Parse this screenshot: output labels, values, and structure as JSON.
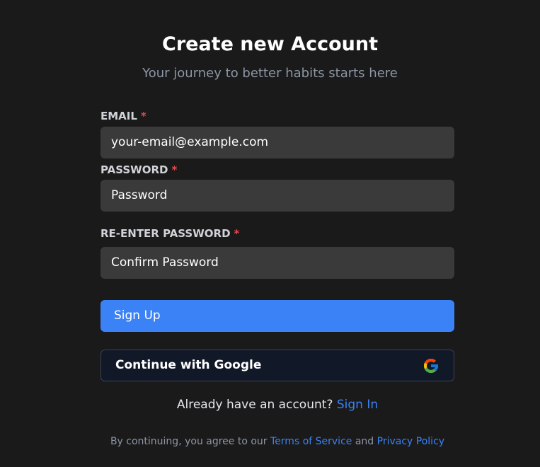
{
  "header": {
    "title": "Create new Account",
    "subtitle": "Your journey to better habits starts here"
  },
  "form": {
    "email": {
      "label": "EMAIL",
      "required_mark": "*",
      "placeholder": "your-email@example.com"
    },
    "password": {
      "label": "PASSWORD",
      "required_mark": "*",
      "placeholder": "Password"
    },
    "confirm_password": {
      "label": "RE-ENTER PASSWORD",
      "required_mark": "*",
      "placeholder": "Confirm Password"
    },
    "signup_button": "Sign Up",
    "google_button": "Continue with Google"
  },
  "signin": {
    "prompt": "Already have an account?",
    "link": "Sign In"
  },
  "footer": {
    "prefix": "By continuing, you agree to our",
    "terms_link": "Terms of Service",
    "conjunction": "and",
    "privacy_link": "Privacy Policy"
  },
  "colors": {
    "background": "#1a1a1a",
    "input_bg": "#3a3a3a",
    "accent": "#3b82f6",
    "required": "#e5484d",
    "google_button_bg": "#111827"
  },
  "icons": {
    "google": "google-logo-icon"
  }
}
